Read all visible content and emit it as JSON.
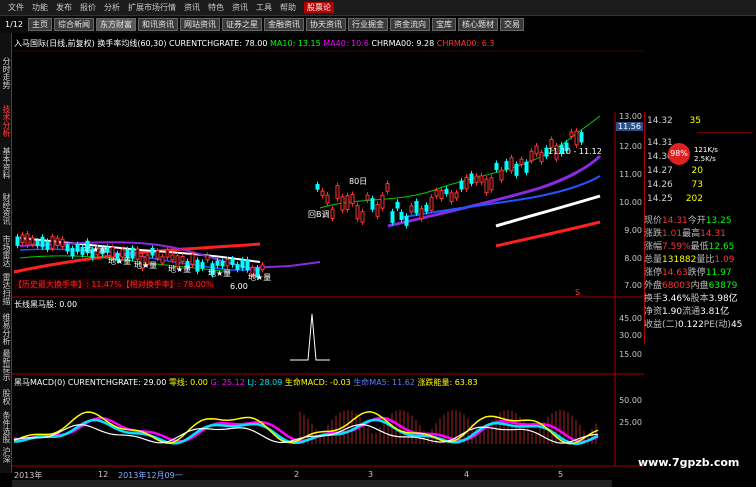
{
  "app": {
    "menu": [
      "文件",
      "功能",
      "发布",
      "报价",
      "分析",
      "扩展市场行情",
      "资讯",
      "特色",
      "资讯",
      "工具",
      "帮助"
    ],
    "brand": "股票论"
  },
  "nav": {
    "page_indicator": "1/12",
    "tabs": [
      "主页",
      "综合新闻",
      "东方财富",
      "和讯资讯",
      "网站资讯",
      "证券之星",
      "金融资讯",
      "协天资讯",
      "行业掘金",
      "资金流向",
      "宝库",
      "核心题材",
      "交易"
    ]
  },
  "sidebar": {
    "items": [
      "分时走势",
      "技术分析",
      "基本资料",
      "财经资讯",
      "市场雷达",
      "雷达扫描",
      "维易分析",
      "最新提示",
      "股权",
      "条件选股",
      "沪深",
      "交易"
    ]
  },
  "main_chart": {
    "header": {
      "stock": "入马国际(日线,前复权)",
      "indicator": "换手率均线(60,30)",
      "curent": "CURENTCHGRATE: 78.00",
      "ma10": "MA10: 13.15",
      "ma40": "MA40: 10.6",
      "chrma00": "CHRMA00: 9.28",
      "chrma": "CHRMA00: 6.3"
    },
    "yticks": [
      "13.00",
      "12.00",
      "11.00",
      "10.00",
      "9.00",
      "8.00",
      "7.00",
      "6.00"
    ],
    "annotations": {
      "b80": "80日",
      "low_label": "6.00",
      "buy_label": "B",
      "range_label": "11.10 - 11.12",
      "price_label": "11.56",
      "history_note": "【历史最大换手率】: 11.47%【相对换手率】: 78.00%",
      "signal_labels": [
        "地★量",
        "地★量",
        "地★量",
        "地★量",
        "地★量",
        "地★量"
      ],
      "sell": "S"
    }
  },
  "volume_chart": {
    "header": "长线黑马股: 0.00",
    "yticks": [
      "45.00",
      "30.00",
      "15.00"
    ]
  },
  "macd_chart": {
    "header": {
      "title": "黑马MACD(0) CURENTCHGRATE: 29.00",
      "zero": "零线: 0.00",
      "g": "G: 25.12",
      "lj": "LJ: 28.09",
      "life": "生命MACD: -0.03",
      "lifema": "生命MA5: 11.62",
      "energy": "涨跌能量: 63.83"
    },
    "yticks": [
      "50.00",
      "25.00"
    ]
  },
  "xaxis": {
    "labels": [
      "2013年",
      "12",
      "2013年12月09一",
      "2",
      "3",
      "4",
      "5"
    ]
  },
  "rpanel": {
    "asks": [
      {
        "price": "14.32",
        "vol": "35"
      },
      {
        "price": "14.31",
        "vol": ""
      },
      {
        "price": "14.30",
        "vol": ""
      },
      {
        "price": "14.27",
        "vol": "20"
      },
      {
        "price": "14.26",
        "vol": "73"
      },
      {
        "price": "14.25",
        "vol": "202"
      }
    ],
    "gauge": "98%",
    "gauge_right": [
      "121K/s",
      "2.5K/s"
    ],
    "quote": [
      {
        "k": "现价",
        "v": "14.31",
        "k2": "今开",
        "v2": "13.25",
        "c": "red",
        "c2": "grn"
      },
      {
        "k": "涨跌",
        "v": "1.01",
        "k2": "最高",
        "v2": "14.31",
        "c": "red",
        "c2": "red"
      },
      {
        "k": "涨幅",
        "v": "7.59%",
        "k2": "最低",
        "v2": "12.65",
        "c": "red",
        "c2": "grn"
      },
      {
        "k": "总量",
        "v": "131882",
        "k2": "量比",
        "v2": "1.09",
        "c": "ylw",
        "c2": "red"
      },
      {
        "k": "涨停",
        "v": "14.63",
        "k2": "跌停",
        "v2": "11.97",
        "c": "red",
        "c2": "grn"
      },
      {
        "k": "外盘",
        "v": "68003",
        "k2": "内盘",
        "v2": "63879",
        "c": "red",
        "c2": "grn"
      },
      {
        "k": "换手",
        "v": "3.46%",
        "k2": "股本",
        "v2": "3.98亿",
        "c": "wht",
        "c2": "wht"
      },
      {
        "k": "净资",
        "v": "1.90",
        "k2": "流通",
        "v2": "3.81亿",
        "c": "wht",
        "c2": "wht"
      },
      {
        "k": "收益(二)",
        "v": "0.122",
        "k2": "PE(动)",
        "v2": "45",
        "c": "wht",
        "c2": "wht"
      }
    ]
  },
  "watermark": "www.7gpzb.com",
  "colors": {
    "up": "#ff3333",
    "down": "#00ff00",
    "accent": "#b00000",
    "ma_blue": "#2255ff",
    "ma_purple": "#8a2be2"
  }
}
